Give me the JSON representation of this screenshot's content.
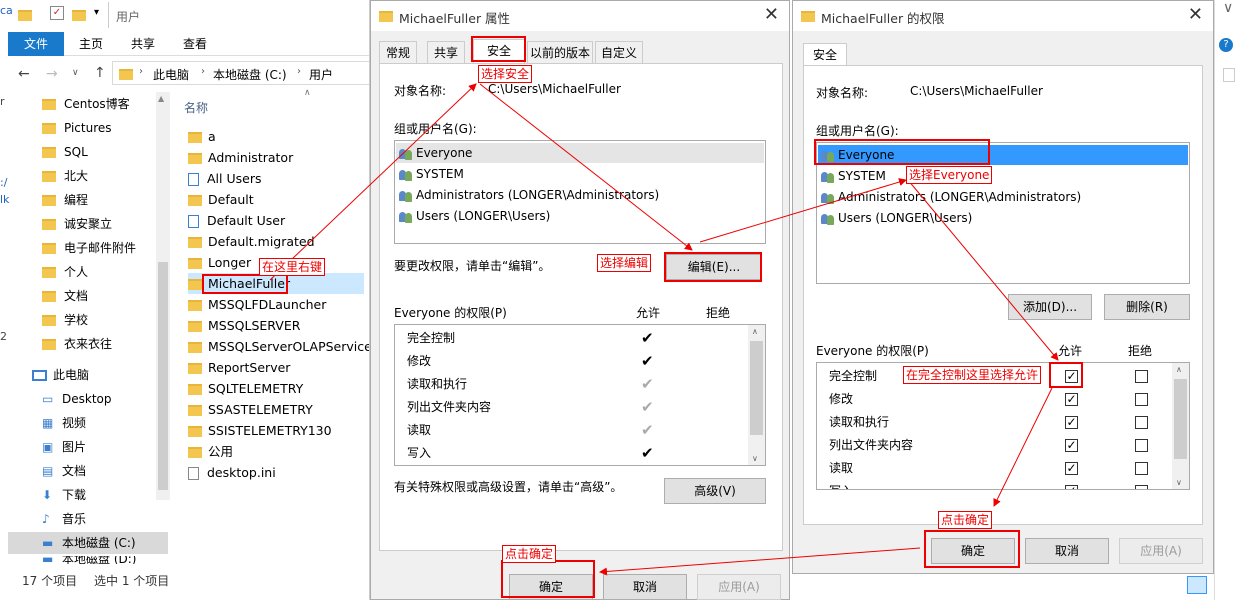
{
  "explorer": {
    "title": "用户",
    "ribbon_tabs": [
      "文件",
      "主页",
      "共享",
      "查看"
    ],
    "path": [
      "此电脑",
      "本地磁盘 (C:)",
      "用户"
    ],
    "column_name": "名称",
    "tree": [
      "Centos博客",
      "Pictures",
      "SQL",
      "北大",
      "编程",
      "诚安聚立",
      "电子邮件附件",
      "个人",
      "文档",
      "学校",
      "衣来衣往"
    ],
    "pc_label": "此电脑",
    "pc_items": [
      "Desktop",
      "视频",
      "图片",
      "文档",
      "下载",
      "音乐",
      "本地磁盘 (C:)",
      "本地磁盘 (D:)"
    ],
    "files": [
      "a",
      "Administrator",
      "All Users",
      "Default",
      "Default User",
      "Default.migrated",
      "Longer",
      "MichaelFuller",
      "MSSQLFDLauncher",
      "MSSQLSERVER",
      "MSSQLServerOLAPService",
      "ReportServer",
      "SQLTELEMETRY",
      "SSASTELEMETRY",
      "SSISTELEMETRY130",
      "公用",
      "desktop.ini"
    ],
    "status_count": "17 个项目",
    "status_selected": "选中 1 个项目",
    "edge_chars": [
      "ca",
      "r",
      ":/",
      "lk",
      "2"
    ]
  },
  "props": {
    "title": "MichaelFuller 属性",
    "tabs": [
      "常规",
      "共享",
      "安全",
      "以前的版本",
      "自定义"
    ],
    "object_label": "对象名称:",
    "object_value": "C:\\Users\\MichaelFuller",
    "group_label": "组或用户名(G):",
    "users": [
      "Everyone",
      "SYSTEM",
      "Administrators (LONGER\\Administrators)",
      "Users (LONGER\\Users)"
    ],
    "edit_hint": "要更改权限，请单击“编辑”。",
    "edit_button": "编辑(E)...",
    "perm_title": "Everyone 的权限(P)",
    "allow": "允许",
    "deny": "拒绝",
    "perms": [
      "完全控制",
      "修改",
      "读取和执行",
      "列出文件夹内容",
      "读取",
      "写入"
    ],
    "adv_hint": "有关特殊权限或高级设置，请单击“高级”。",
    "adv_button": "高级(V)",
    "ok": "确定",
    "cancel": "取消",
    "apply": "应用(A)"
  },
  "perm_dialog": {
    "title": "MichaelFuller 的权限",
    "tab": "安全",
    "object_label": "对象名称:",
    "object_value": "C:\\Users\\MichaelFuller",
    "group_label": "组或用户名(G):",
    "users": [
      "Everyone",
      "SYSTEM",
      "Administrators (LONGER\\Administrators)",
      "Users (LONGER\\Users)"
    ],
    "add_button": "添加(D)...",
    "remove_button": "删除(R)",
    "perm_title": "Everyone 的权限(P)",
    "allow": "允许",
    "deny": "拒绝",
    "perms": [
      "完全控制",
      "修改",
      "读取和执行",
      "列出文件夹内容",
      "读取",
      "写入"
    ],
    "ok": "确定",
    "cancel": "取消",
    "apply": "应用(A)"
  },
  "annotations": {
    "right_click": "在这里右键",
    "choose_security": "选择安全",
    "choose_edit": "选择编辑",
    "choose_everyone": "选择Everyone",
    "full_control_allow": "在完全控制这里选择允许",
    "click_ok_1": "点击确定",
    "click_ok_2": "点击确定"
  },
  "colors": {
    "annotation": "#e00000",
    "selection": "#cce8ff",
    "selection_strong": "#3399ff",
    "accent": "#1979ca"
  }
}
